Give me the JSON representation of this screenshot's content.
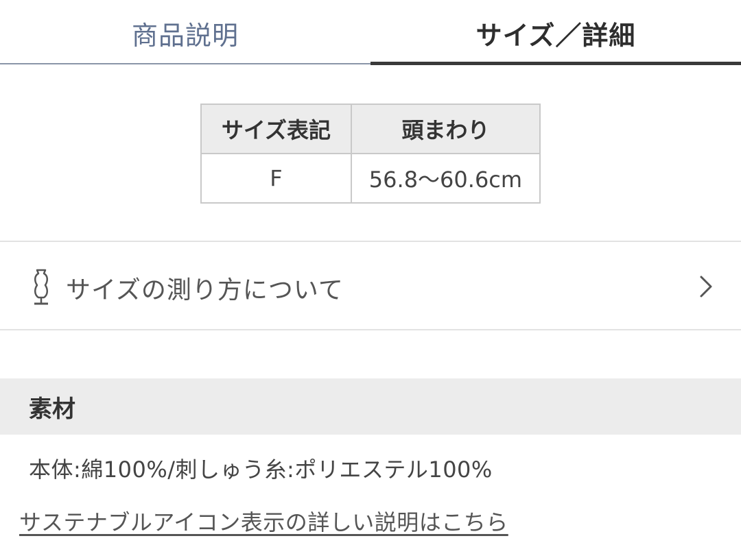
{
  "tabs": [
    {
      "label": "商品説明",
      "active": false
    },
    {
      "label": "サイズ／詳細",
      "active": true
    }
  ],
  "size_table": {
    "headers": [
      "サイズ表記",
      "頭まわり"
    ],
    "rows": [
      [
        "F",
        "56.8〜60.6cm"
      ]
    ]
  },
  "measure_link": {
    "label": "サイズの測り方について",
    "icon": "mannequin-icon",
    "chevron": "chevron-right-icon"
  },
  "material": {
    "heading": "素材",
    "text": "本体:綿100%/刺しゅう糸:ポリエステル100%"
  },
  "sustainable_link": {
    "label": "サステナブルアイコン表示の詳しい説明はこちら"
  },
  "colors": {
    "inactive_tab": "#5f708f",
    "active_tab": "#2e2e2e",
    "header_bg": "#ececec",
    "border": "#c9c9c9"
  }
}
